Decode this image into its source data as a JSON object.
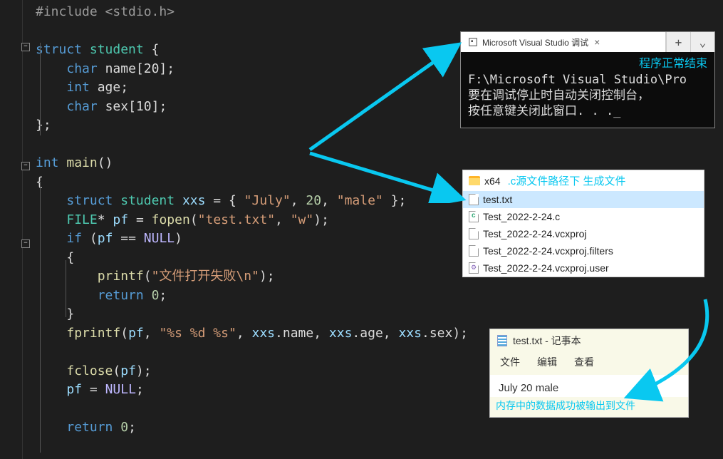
{
  "code": {
    "include": "#include <stdio.h>",
    "struct_kw": "struct",
    "student": "student",
    "char": "char",
    "name": "name",
    "arr20": "[20]",
    "int": "int",
    "age": "age",
    "sex": "sex",
    "arr10": "[10]",
    "main": "main",
    "xxs": "xxs",
    "init_july": "\"July\"",
    "init_20": "20",
    "init_male": "\"male\"",
    "FILE": "FILE",
    "pf": "pf",
    "fopen": "fopen",
    "testtxt": "\"test.txt\"",
    "w": "\"w\"",
    "if": "if",
    "NULL": "NULL",
    "printf": "printf",
    "err": "\"文件打开失败\\n\"",
    "return": "return",
    "zero": "0",
    "fprintf": "fprintf",
    "fmt": "\"%s %d %s\"",
    "fclose": "fclose"
  },
  "console": {
    "tab": "Microsoft Visual Studio 调试",
    "status": "程序正常结束",
    "path": "F:\\Microsoft Visual Studio\\Pro",
    "msg1": "要在调试停止时自动关闭控制台，",
    "msg2": "按任意键关闭此窗口. . ._"
  },
  "explorer": {
    "folder": "x64",
    "note": ".c源文件路径下 生成文件",
    "files": [
      "test.txt",
      "Test_2022-2-24.c",
      "Test_2022-2-24.vcxproj",
      "Test_2022-2-24.vcxproj.filters",
      "Test_2022-2-24.vcxproj.user"
    ]
  },
  "notepad": {
    "title": "test.txt - 记事本",
    "menu": [
      "文件",
      "编辑",
      "查看"
    ],
    "content": "July 20 male",
    "note": "内存中的数据成功被输出到文件"
  }
}
